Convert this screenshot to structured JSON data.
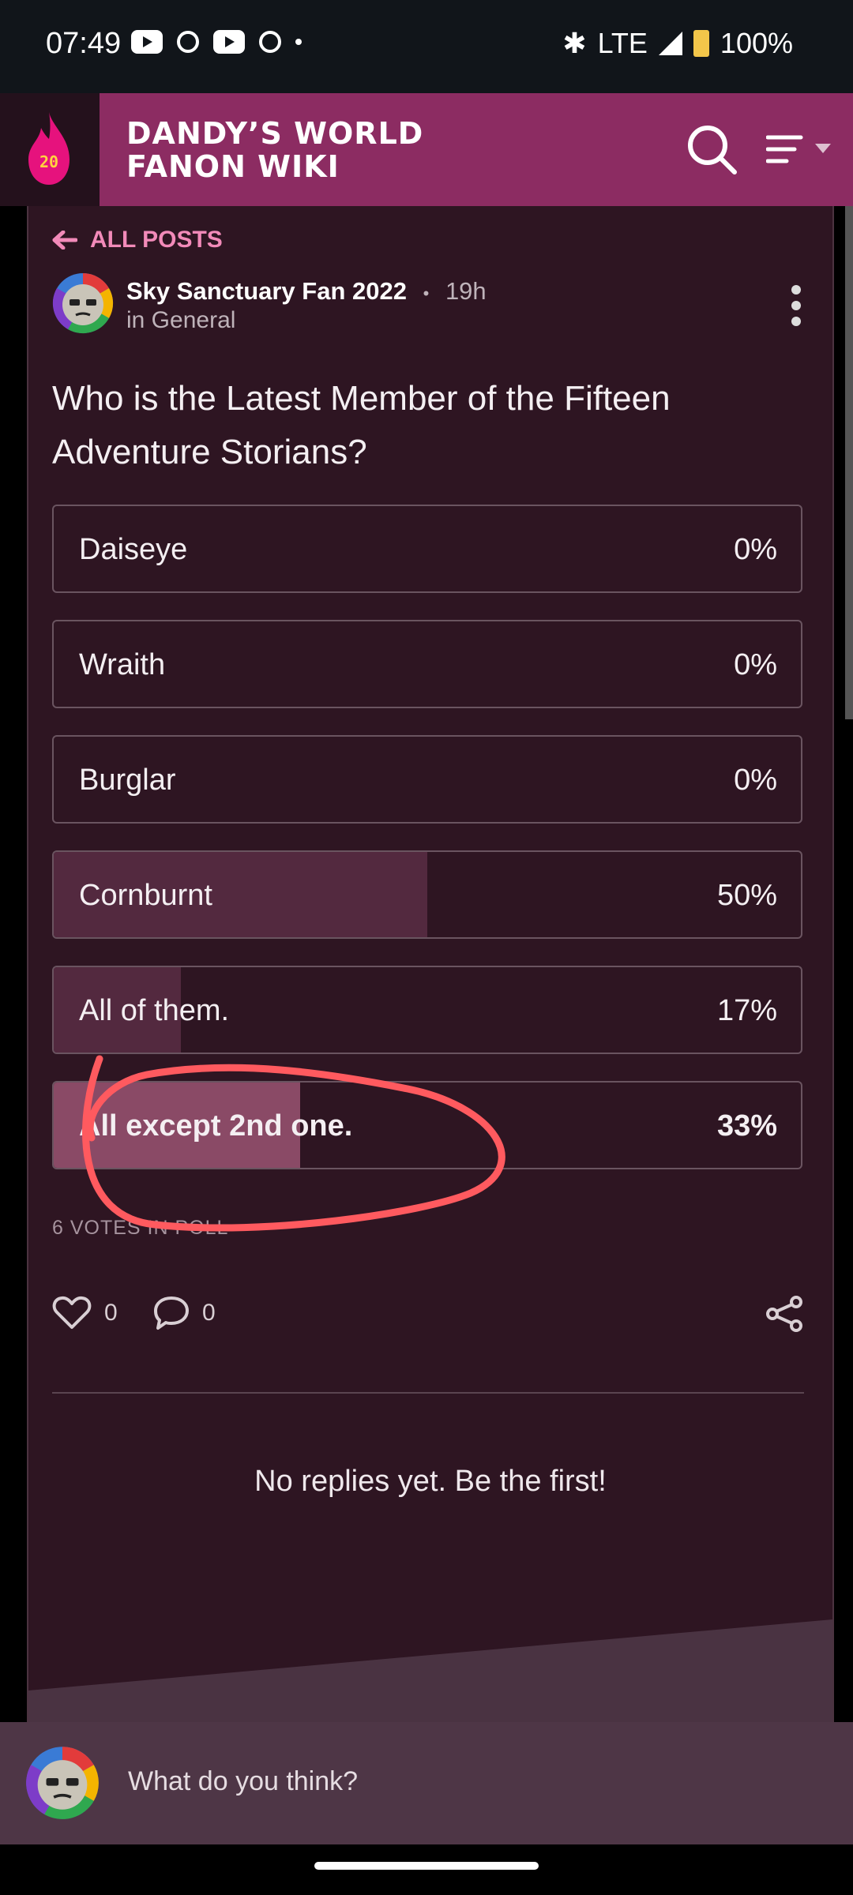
{
  "status_bar": {
    "time": "07:49",
    "network": "LTE",
    "battery": "100%"
  },
  "header": {
    "logo_badge": "20",
    "site_title": "DANDY’S WORLD FANON WIKI"
  },
  "post": {
    "back_label": "ALL POSTS",
    "author": "Sky Sanctuary Fan 2022",
    "separator": "•",
    "time_ago": "19h",
    "category": "in General",
    "question": "Who is the Latest Member of the Fifteen Adventure Storians?",
    "poll": {
      "options": [
        {
          "label": "Daiseye",
          "percent": "0%",
          "fraction": 0
        },
        {
          "label": "Wraith",
          "percent": "0%",
          "fraction": 0
        },
        {
          "label": "Burglar",
          "percent": "0%",
          "fraction": 0
        },
        {
          "label": "Cornburnt",
          "percent": "50%",
          "fraction": 0.5
        },
        {
          "label": "All of them.",
          "percent": "17%",
          "fraction": 0.17
        },
        {
          "label": "All except 2nd one.",
          "percent": "33%",
          "fraction": 0.33,
          "selected": true
        }
      ],
      "votes_text": "6 VOTES IN POLL"
    },
    "likes": "0",
    "comments": "0",
    "no_replies": "No replies yet. Be the first!"
  },
  "reply_bar": {
    "placeholder": "What do you think?"
  },
  "colors": {
    "brand": "#8c2c62",
    "page_bg": "#2e1522",
    "accent_link": "#f28ab9",
    "annotation": "#ff5a5f"
  }
}
